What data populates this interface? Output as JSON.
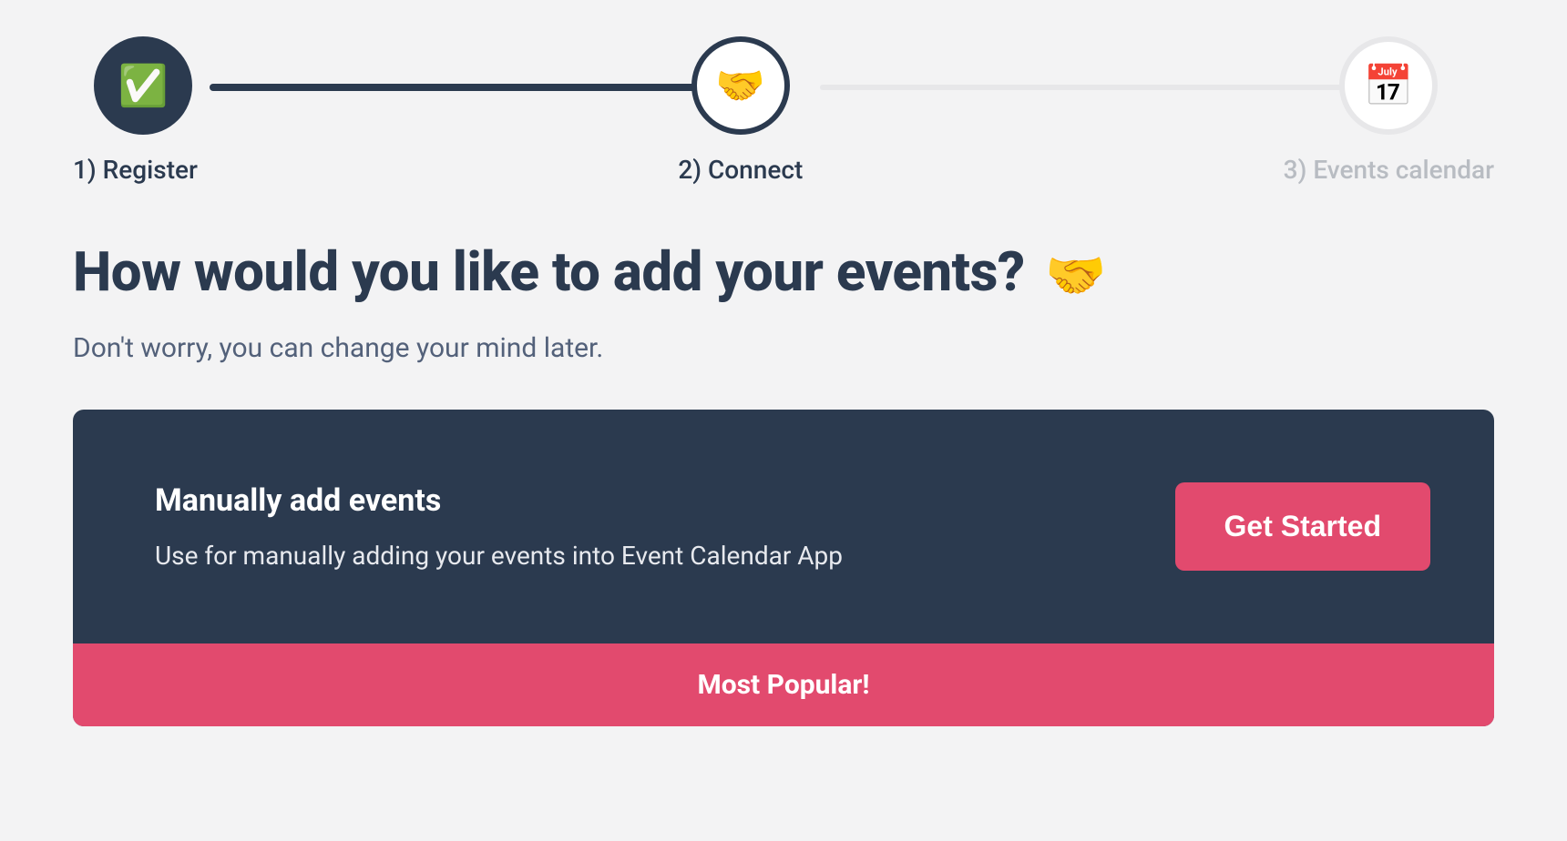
{
  "stepper": {
    "steps": [
      {
        "icon": "✅",
        "label": "1) Register",
        "state": "done"
      },
      {
        "icon": "🤝",
        "label": "2) Connect",
        "state": "active"
      },
      {
        "icon": "📅",
        "label": "3) Events calendar",
        "state": "upcoming"
      }
    ]
  },
  "heading": {
    "text": "How would you like to add your events?",
    "emoji": "🤝"
  },
  "subheading": "Don't worry, you can change your mind later.",
  "card": {
    "title": "Manually add events",
    "description": "Use for manually adding your events into Event Calendar App",
    "button": "Get Started",
    "footer": "Most Popular!"
  }
}
